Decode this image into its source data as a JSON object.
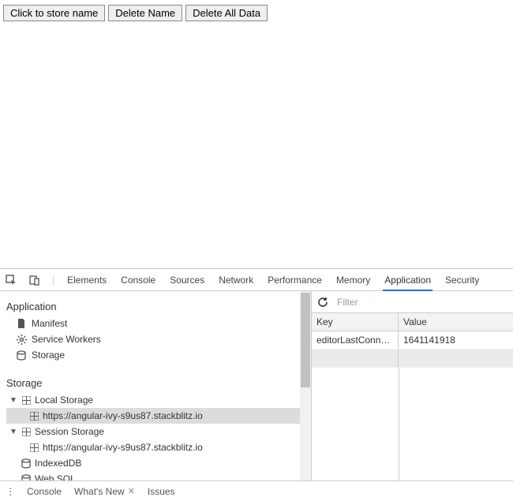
{
  "page": {
    "buttons": {
      "store": "Click to store name",
      "deleteName": "Delete Name",
      "deleteAll": "Delete All Data"
    }
  },
  "devtools": {
    "tabs": {
      "elements": "Elements",
      "console": "Console",
      "sources": "Sources",
      "network": "Network",
      "performance": "Performance",
      "memory": "Memory",
      "application": "Application",
      "security": "Security"
    },
    "activeTab": "Application",
    "sidebar": {
      "appSection": "Application",
      "appItems": {
        "manifest": "Manifest",
        "serviceWorkers": "Service Workers",
        "storage": "Storage"
      },
      "storageSection": "Storage",
      "storageTree": {
        "localStorage": "Local Storage",
        "localStorageOrigin": "https://angular-ivy-s9us87.stackblitz.io",
        "sessionStorage": "Session Storage",
        "sessionStorageOrigin": "https://angular-ivy-s9us87.stackblitz.io",
        "indexedDB": "IndexedDB",
        "webSQL": "Web SQL"
      }
    },
    "storagePanel": {
      "filterPlaceholder": "Filter",
      "keyHeader": "Key",
      "valueHeader": "Value",
      "row0": {
        "key": "editorLastConnec...",
        "value": "1641141918"
      }
    },
    "drawer": {
      "console": "Console",
      "whatsNew": "What's New",
      "issues": "Issues"
    }
  }
}
